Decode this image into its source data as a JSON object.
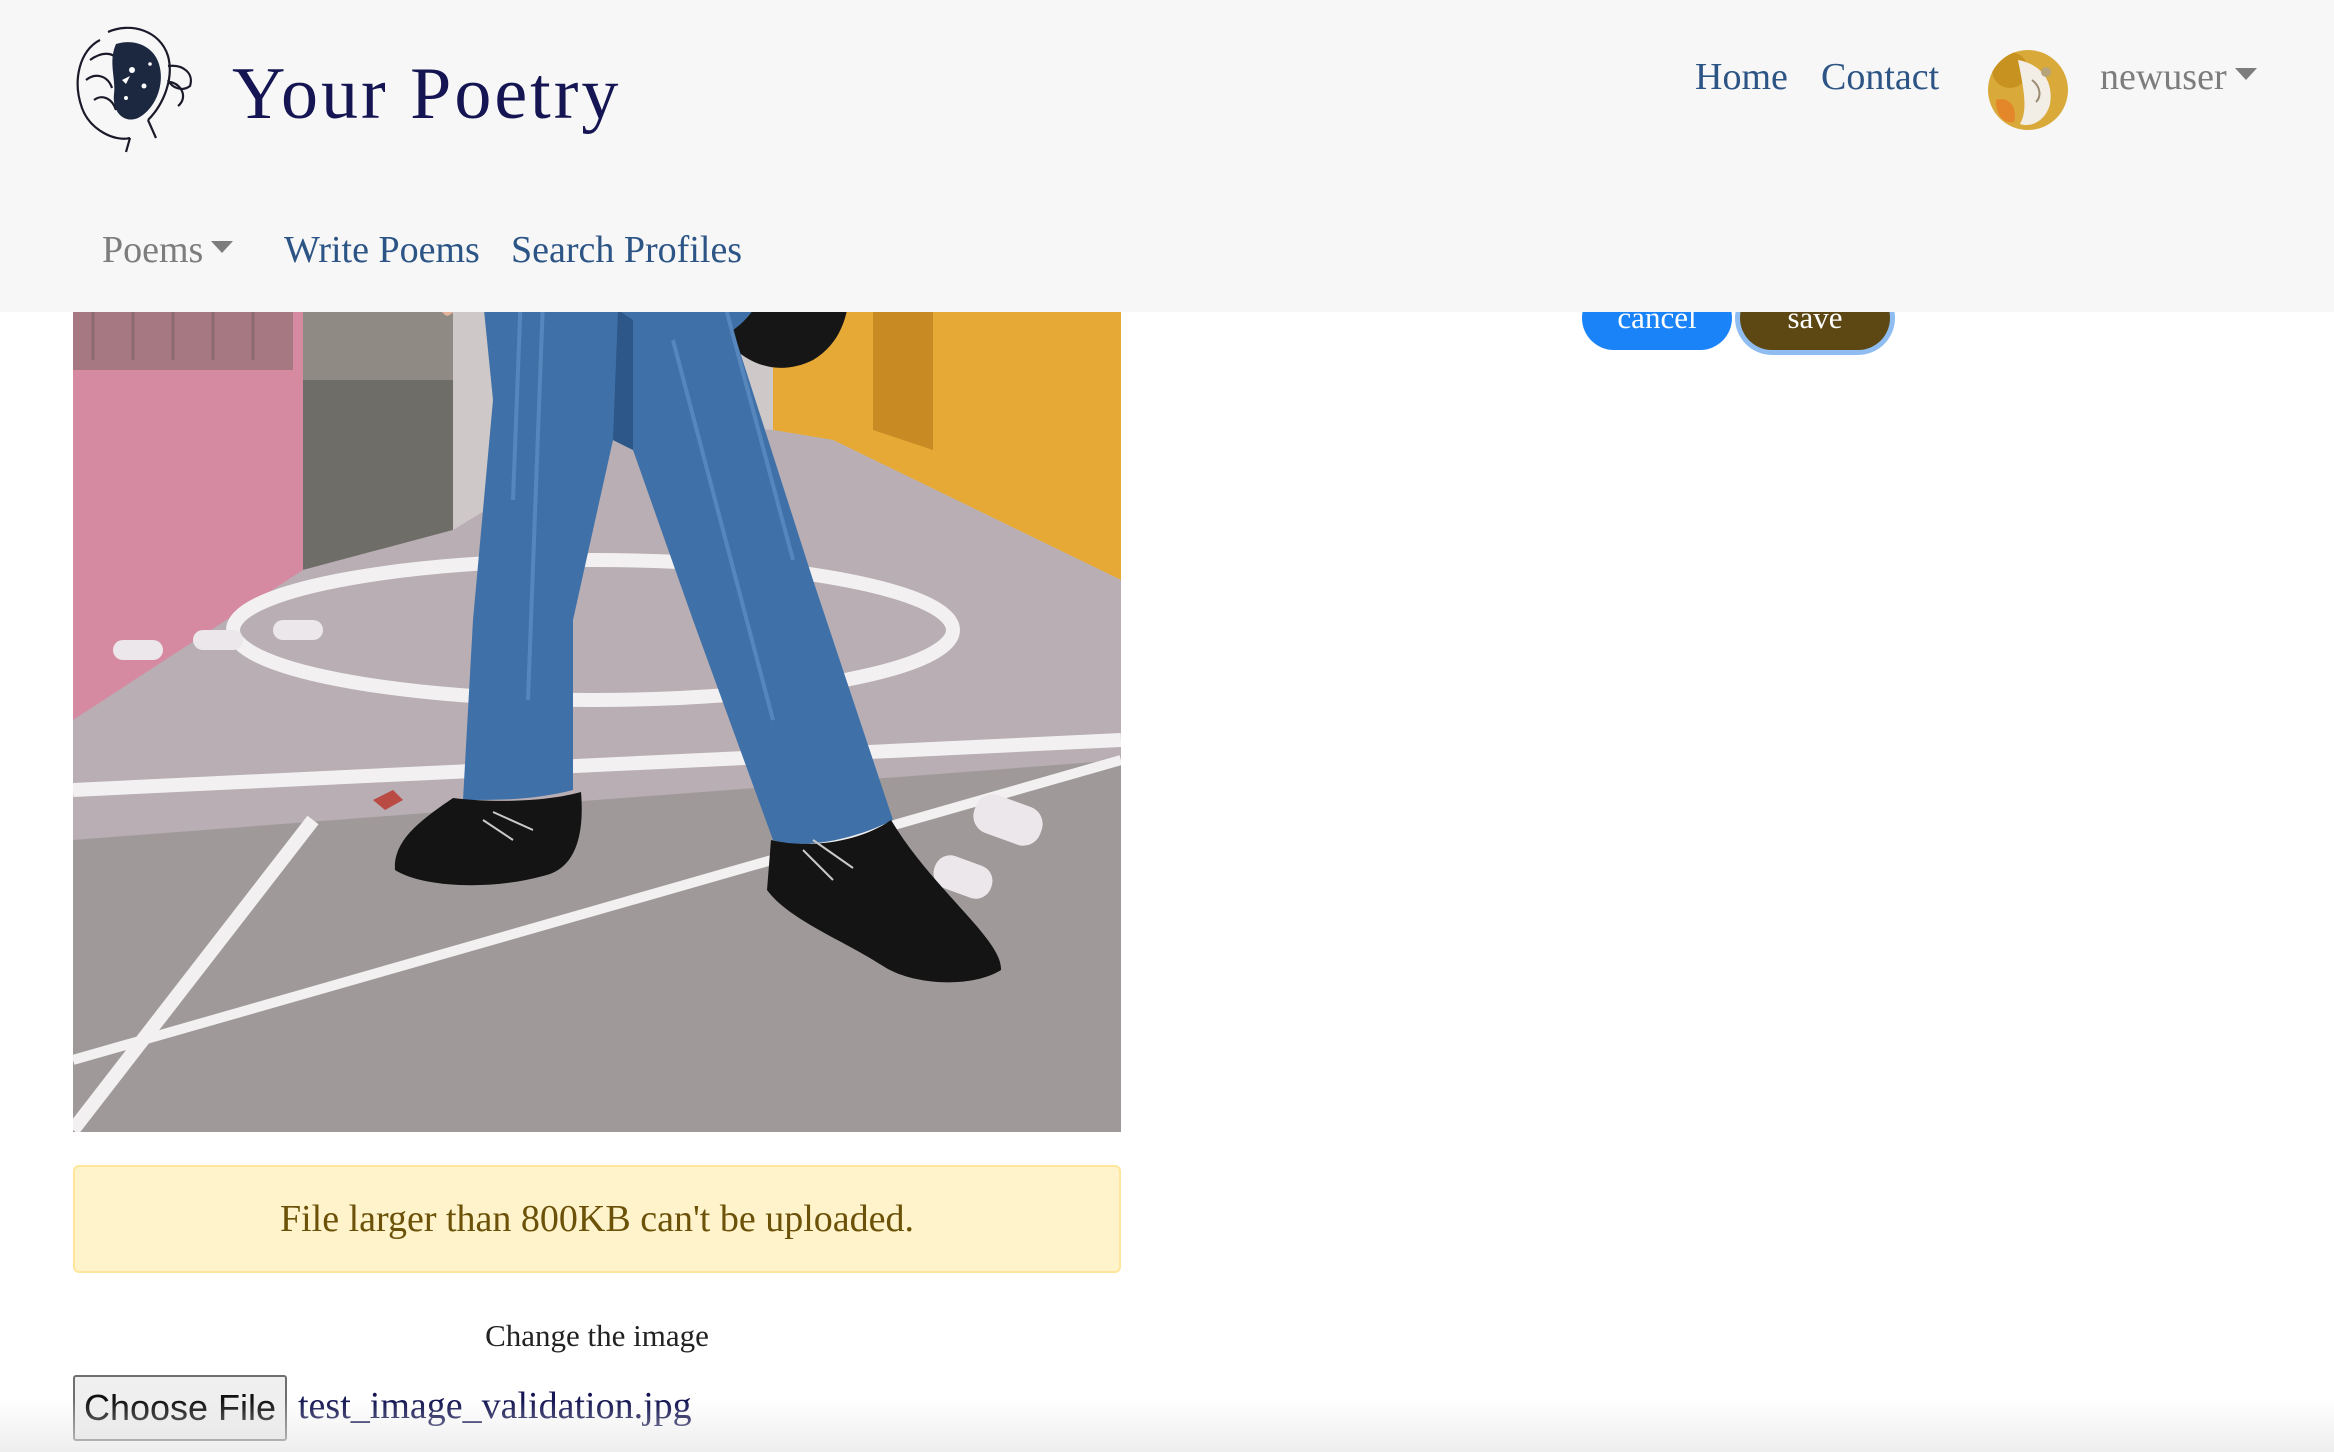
{
  "brand": {
    "title": "Your Poetry",
    "logo_icon": "poet-face-illustration-icon"
  },
  "top_nav": {
    "home": "Home",
    "contact": "Contact",
    "username": "newuser"
  },
  "sub_nav": {
    "poems": "Poems",
    "write_poems": "Write Poems",
    "search_profiles": "Search Profiles"
  },
  "actions": {
    "cancel": "cancel",
    "save": "save"
  },
  "alert": {
    "message": "File larger than 800KB can't be uploaded."
  },
  "upload": {
    "label": "Change the image",
    "choose_button": "Choose File",
    "file_name": "test_image_validation.jpg"
  },
  "colors": {
    "brand_text": "#141552",
    "nav_link": "#2c5485",
    "cancel_button": "#1a83f7",
    "save_button": "#5d4813",
    "alert_bg": "#fff3cc",
    "alert_text": "#6b5208"
  }
}
